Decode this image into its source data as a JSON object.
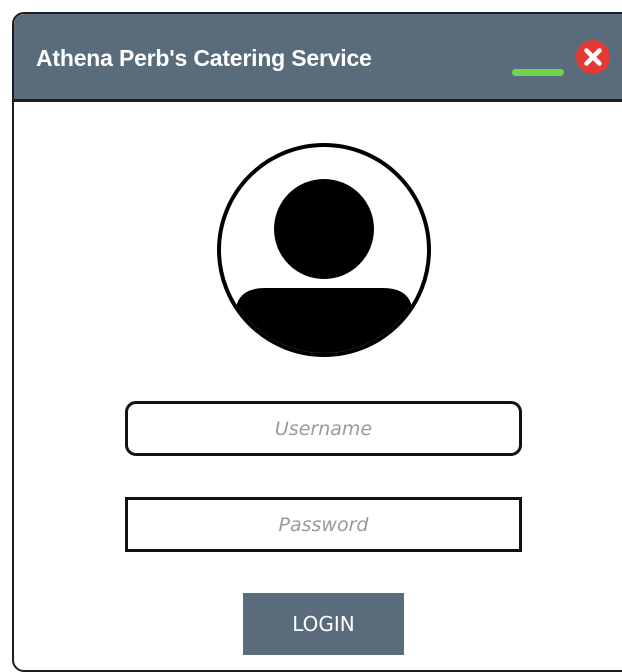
{
  "window": {
    "title": "Athena Perb's Catering Service"
  },
  "controls": {
    "minimize_icon": "minimize-icon",
    "close_icon": "close-icon"
  },
  "form": {
    "avatar_icon": "user-avatar-icon",
    "username": {
      "value": "",
      "placeholder": "Username"
    },
    "password": {
      "value": "",
      "placeholder": "Password"
    },
    "login_label": "LOGIN"
  },
  "colors": {
    "titlebar": "#5a6b7c",
    "minimize": "#6fd44e",
    "close": "#e53935",
    "button": "#5a6b7c",
    "border": "#111111"
  }
}
